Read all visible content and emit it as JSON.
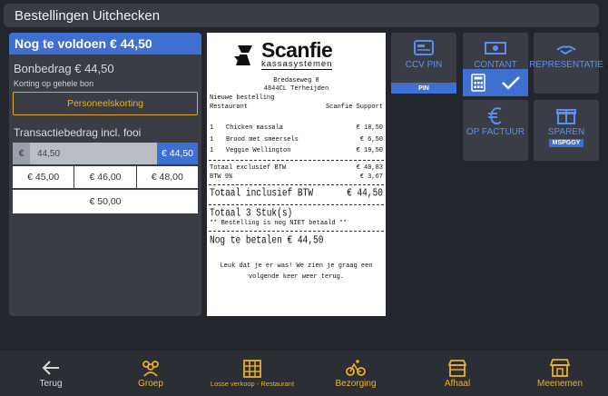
{
  "window": {
    "title": "Bestellingen Uitchecken"
  },
  "left": {
    "due_label": "Nog te voldoen € 44,50",
    "bon_label": "Bonbedrag € 44,50",
    "korting_label": "Korting op gehele bon",
    "korting_button": "Personeelskorting",
    "trans_label": "Transactiebedrag incl. fooi",
    "currency": "€",
    "amount_value": "44,50",
    "amount_button": "€ 44,50",
    "tips": [
      "€ 45,00",
      "€ 46,00",
      "€ 48,00"
    ],
    "tip_wide": "€ 50,00"
  },
  "receipt": {
    "logo_name": "Scanfie",
    "logo_sub": "kassasystemen",
    "address1": "Bredaseweg 8",
    "address2": "4844CL Terheijden",
    "new_order": "Nieuwe bestelling",
    "restaurant": "Restaurant",
    "support": "Scanfie Support",
    "items": [
      {
        "qty": "1",
        "name": "Chicken massala",
        "price": "€ 18,50"
      },
      {
        "qty": "1",
        "name": "Brood met smeersels",
        "price": "€ 6,50"
      },
      {
        "qty": "1",
        "name": "Veggie Wellington",
        "price": "€ 19,50"
      }
    ],
    "excl_label": "Totaal exclusief BTW",
    "excl_value": "€ 40,83",
    "btw_label": "BTW 9%",
    "btw_value": "€ 3,67",
    "incl_label": "Totaal inclusief BTW",
    "incl_value": "€ 44,50",
    "count_label": "Totaal 3 Stuk(s)",
    "unpaid_note": "** Bestelling is nog NIET betaald **",
    "to_pay": "Nog te betalen € 44,50",
    "thanks": "Leuk dat je er was! We zien je graag een volgende keer weer terug."
  },
  "payment": {
    "ccv_label": "CCV PIN",
    "ccv_badge": "PIN",
    "contant_label": "CONTANT",
    "representatie_label": "REPRESENTATIE",
    "factuur_label": "OP FACTUUR",
    "sparen_label": "SPAREN",
    "sparen_badge": "MSPGGY"
  },
  "nav": {
    "back": "Terug",
    "groep": "Groep",
    "losse": "Losse verkoop - Restaurant",
    "bezorging": "Bezorging",
    "afhaal": "Afhaal",
    "meenemen": "Meenemen"
  },
  "colors": {
    "accent": "#3f6fd1",
    "warning": "#e9ae2e",
    "panel": "#3a3d45",
    "background": "#23262d"
  }
}
